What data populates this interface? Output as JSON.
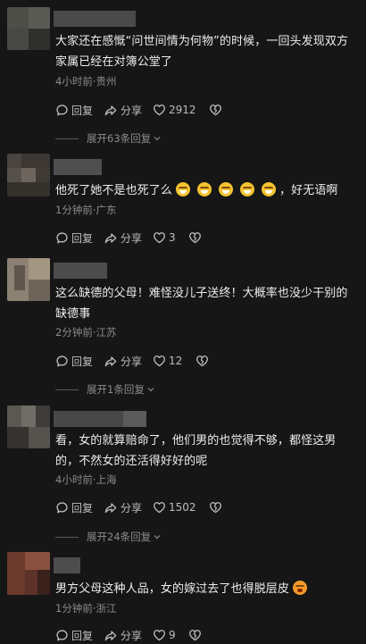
{
  "comments": [
    {
      "text": "大家还在感慨“问世间情为何物”的时候，一回头发现双方家属已经在对簿公堂了",
      "meta": "4小时前·贵州",
      "reply_label": "回复",
      "share_label": "分享",
      "like_count": "2912",
      "expand_label": "展开63条回复"
    },
    {
      "text_before": "他死了她不是也死了么",
      "text_after": "，好无语啊",
      "emoji_name": "crying-laughing-emoji",
      "meta": "1分钟前·广东",
      "reply_label": "回复",
      "share_label": "分享",
      "like_count": "3"
    },
    {
      "text": "这么缺德的父母！难怪没儿子送终！大概率也没少干别的缺德事",
      "meta": "2分钟前·江苏",
      "reply_label": "回复",
      "share_label": "分享",
      "like_count": "12",
      "expand_label": "展开1条回复"
    },
    {
      "text": "看，女的就算赔命了，他们男的也觉得不够，都怪这男的，不然女的还活得好好的呢",
      "meta": "4小时前·上海",
      "reply_label": "回复",
      "share_label": "分享",
      "like_count": "1502",
      "expand_label": "展开24条回复"
    },
    {
      "text": "男方父母这种人品，女的嫁过去了也得脱层皮",
      "emoji_name": "blushing-emoji",
      "meta": "1分钟前·浙江",
      "reply_label": "回复",
      "share_label": "分享",
      "like_count": "9"
    }
  ],
  "icons": {
    "reply": "speech-bubble-icon",
    "share": "share-arrow-icon",
    "like": "heart-icon",
    "dislike": "broken-heart-icon",
    "expand": "chevron-down-icon"
  },
  "colors": {
    "background": "#161616",
    "text": "#ededed",
    "meta": "#8b8b8b",
    "actions": "#bdbdbd"
  }
}
